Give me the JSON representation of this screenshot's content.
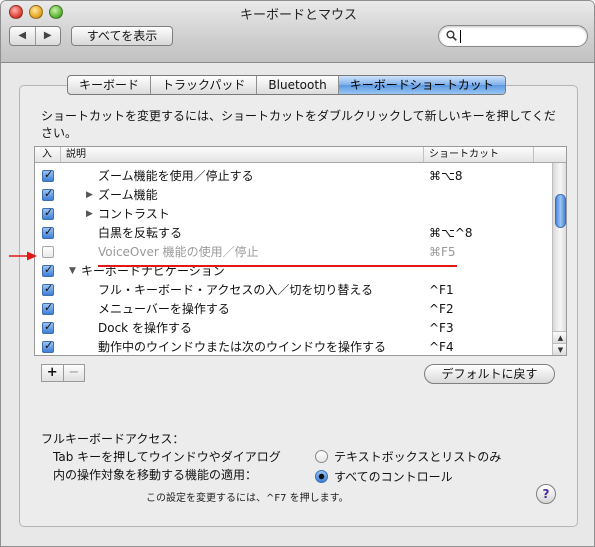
{
  "window": {
    "title": "キーボードとマウス"
  },
  "toolbar": {
    "back_label": "◀",
    "forward_label": "▶",
    "show_all_label": "すべてを表示",
    "search_value": ""
  },
  "tabs": [
    {
      "label": "キーボード",
      "active": false
    },
    {
      "label": "トラックパッド",
      "active": false
    },
    {
      "label": "Bluetooth",
      "active": false
    },
    {
      "label": "キーボードショートカット",
      "active": true
    }
  ],
  "instructions": "ショートカットを変更するには、ショートカットをダブルクリックして新しいキーを押してください。",
  "list": {
    "col_on": "入",
    "col_desc": "説明",
    "col_shortcut": "ショートカット",
    "rows": [
      {
        "checked": true,
        "indent": 2,
        "expander": "",
        "label": "ズーム機能を使用／停止する",
        "shortcut": "⌘⌥8",
        "dim": false
      },
      {
        "checked": true,
        "indent": 2,
        "expander": "▶",
        "label": "ズーム機能",
        "shortcut": "",
        "dim": false
      },
      {
        "checked": true,
        "indent": 2,
        "expander": "▶",
        "label": "コントラスト",
        "shortcut": "",
        "dim": false
      },
      {
        "checked": true,
        "indent": 2,
        "expander": "",
        "label": "白黒を反転する",
        "shortcut": "⌘⌥^8",
        "dim": false
      },
      {
        "checked": false,
        "indent": 2,
        "expander": "",
        "label": "VoiceOver 機能の使用／停止",
        "shortcut": "⌘F5",
        "dim": true
      },
      {
        "checked": true,
        "indent": 1,
        "expander": "▼",
        "label": "キーボードナビゲーション",
        "shortcut": "",
        "dim": false
      },
      {
        "checked": true,
        "indent": 2,
        "expander": "",
        "label": "フル・キーボード・アクセスの入／切を切り替える",
        "shortcut": "^F1",
        "dim": false
      },
      {
        "checked": true,
        "indent": 2,
        "expander": "",
        "label": "メニューバーを操作する",
        "shortcut": "^F2",
        "dim": false
      },
      {
        "checked": true,
        "indent": 2,
        "expander": "",
        "label": "Dock を操作する",
        "shortcut": "^F3",
        "dim": false
      },
      {
        "checked": true,
        "indent": 2,
        "expander": "",
        "label": "動作中のウインドウまたは次のウインドウを操作する",
        "shortcut": "^F4",
        "dim": false
      }
    ]
  },
  "buttons": {
    "plus": "+",
    "minus": "−",
    "restore_defaults": "デフォルトに戻す",
    "help": "?"
  },
  "full_keyboard_access": {
    "heading": "フルキーボードアクセス：",
    "description_line1": "Tab キーを押してウインドウやダイアログ",
    "description_line2": "内の操作対象を移動する機能の適用：",
    "option_text_lists": "テキストボックスとリストのみ",
    "option_all_controls": "すべてのコントロール",
    "selected": "all_controls",
    "note": "この設定を変更するには、^F7 を押します。"
  },
  "colors": {
    "annotation": "#e21818",
    "accent": "#5c98e0"
  }
}
